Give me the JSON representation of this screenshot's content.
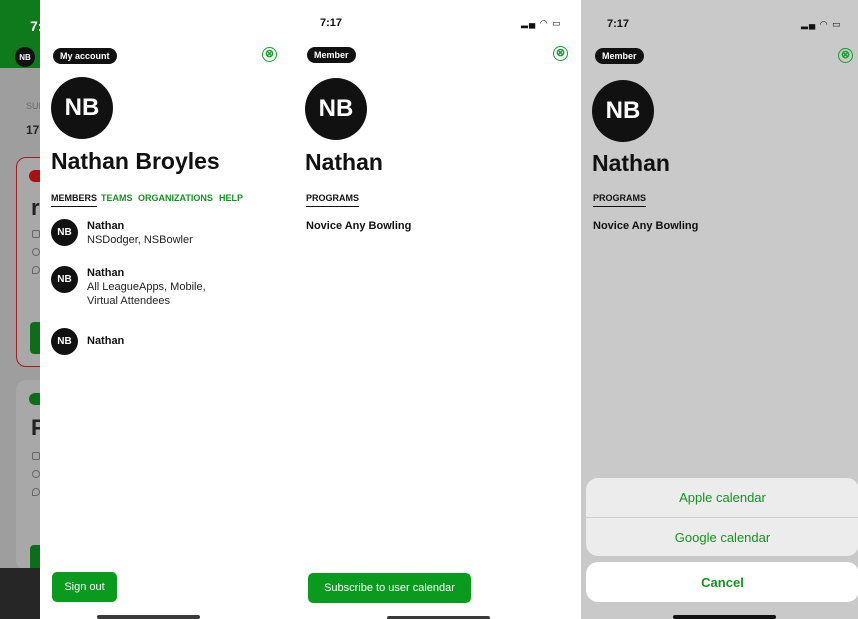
{
  "background_app": {
    "time": "7:",
    "avatar_initials": "NB",
    "sub_label": "SUI",
    "sub_value": "17",
    "card1_title": "r",
    "card2_title": "F"
  },
  "panel1": {
    "chip": "My account",
    "close_icon": "⊗",
    "avatar_initials": "NB",
    "name": "Nathan Broyles",
    "tabs": [
      "MEMBERS",
      "TEAMS",
      "ORGANIZATIONS",
      "HELP"
    ],
    "members": [
      {
        "initials": "NB",
        "name": "Nathan",
        "sub": "NSDodger, NSBowler"
      },
      {
        "initials": "NB",
        "name": "Nathan",
        "sub": "All LeagueApps, Mobile, Virtual Attendees"
      },
      {
        "initials": "NB",
        "name": "Nathan",
        "sub": ""
      }
    ],
    "sign_out": "Sign out"
  },
  "panel2": {
    "time": "7:17",
    "status_icons": "▂▄ ◠ ▭",
    "chip": "Member",
    "close_icon": "⊗",
    "avatar_initials": "NB",
    "name": "Nathan",
    "tab": "PROGRAMS",
    "program": "Novice Any Bowling",
    "subscribe": "Subscribe to user calendar"
  },
  "panel3": {
    "time": "7:17",
    "status_icons": "▂▄ ◠ ▭",
    "chip": "Member",
    "close_icon": "⊗",
    "avatar_initials": "NB",
    "name": "Nathan",
    "tab": "PROGRAMS",
    "program": "Novice Any Bowling",
    "sheet_options": [
      "Apple calendar",
      "Google calendar"
    ],
    "cancel": "Cancel"
  },
  "colors": {
    "accent_green": "#13931f",
    "button_green": "#0a9a1e",
    "dim_overlay": "#c9c9c9"
  }
}
